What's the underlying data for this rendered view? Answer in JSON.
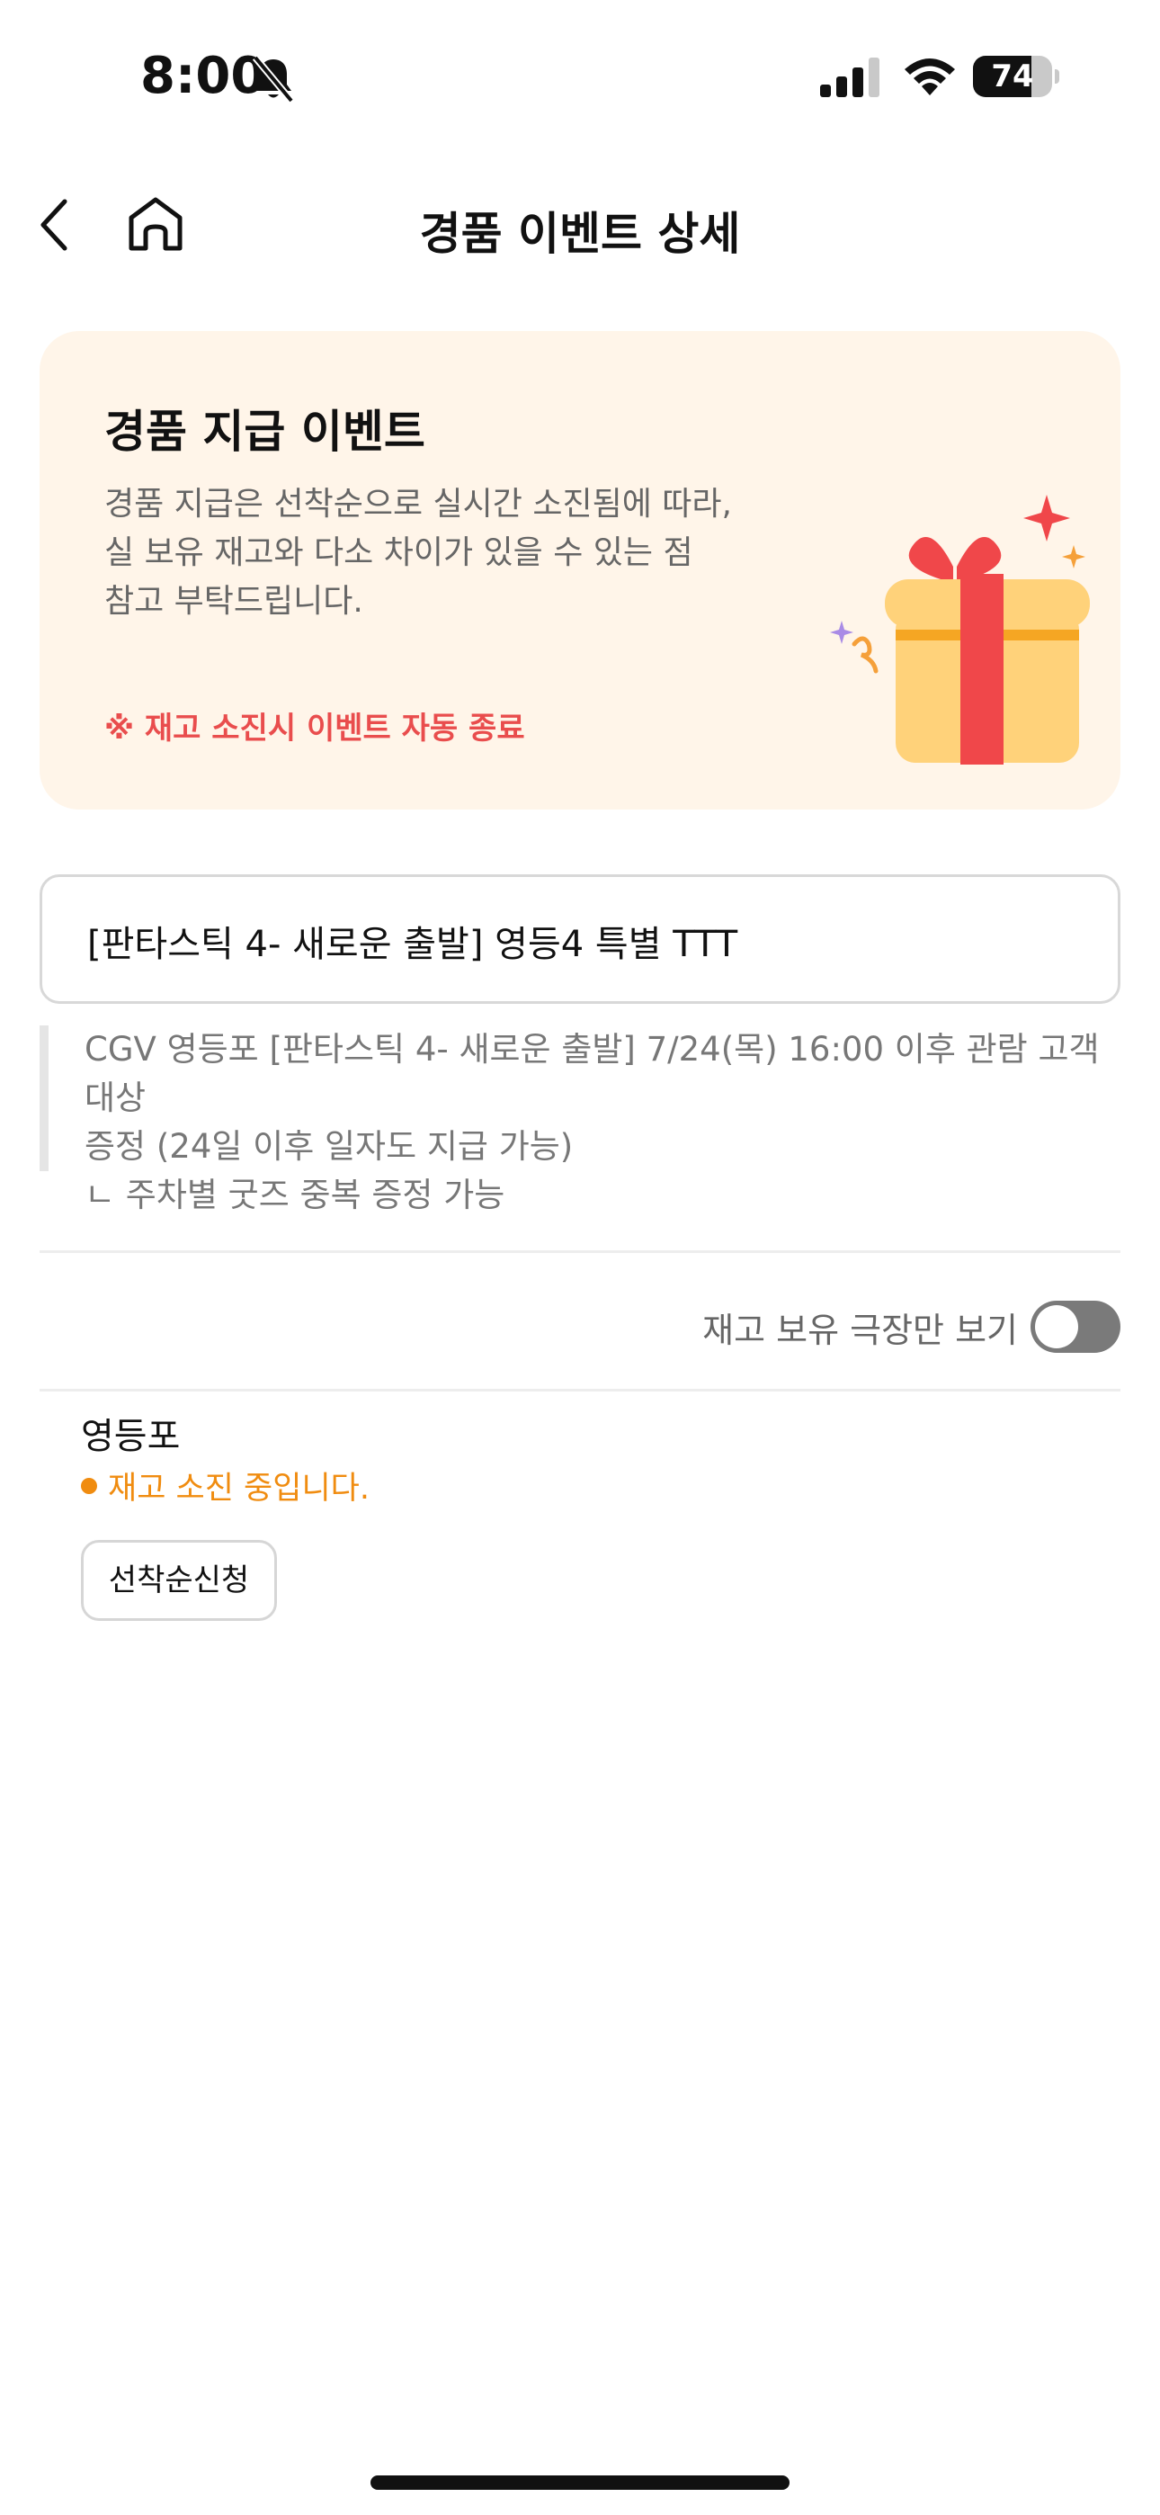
{
  "status_bar": {
    "time": "8:00",
    "battery_percent": "74",
    "battery_level": 0.74,
    "icons": [
      "bell-slash-icon",
      "cellular-signal-icon",
      "wifi-icon",
      "battery-icon"
    ]
  },
  "nav": {
    "title": "경품 이벤트 상세",
    "back_icon": "chevron-left-icon",
    "home_icon": "home-icon"
  },
  "info_card": {
    "title": "경품 지급 이벤트",
    "description_lines": [
      "경품 지급은 선착순으로 실시간 소진됨에 따라,",
      "실 보유 재고와 다소 차이가 있을 수 있는 점",
      "참고 부탁드립니다."
    ],
    "warning": "※ 재고 소진시 이벤트 자동 종료",
    "illustration_icon": "gift-box-icon",
    "colors": {
      "background": "#fff5e9",
      "warning": "#e94d4d",
      "ribbon": "#f0474a",
      "box": "#ffd27a"
    }
  },
  "event": {
    "name": "[판타스틱 4- 새로운 출발] 영등4 특별 TTT",
    "description_lines": [
      "CGV 영등포 [판타스틱 4- 새로운 출발] 7/24(목) 16:00 이후 관람 고객 대상",
      "증정 (24일 이후 일자도 지급 가능)",
      "ㄴ 주차별 굿즈 중복 증정 가능"
    ]
  },
  "filter": {
    "label": "재고 보유 극장만 보기",
    "enabled": false
  },
  "theaters": [
    {
      "name": "영등포",
      "status": "재고 소진 중입니다.",
      "status_color": "#f08c10",
      "button_label": "선착순신청"
    }
  ]
}
